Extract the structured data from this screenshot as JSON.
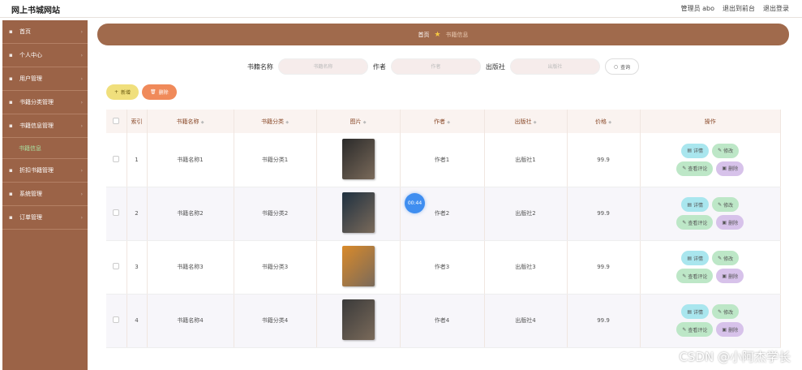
{
  "header": {
    "logo": "网上书城网站",
    "links": [
      "管理员 abo",
      "退出到前台",
      "退出登录"
    ]
  },
  "sidebar": {
    "items": [
      {
        "label": "首页",
        "icon": "home-icon"
      },
      {
        "label": "个人中心",
        "icon": "user-icon"
      },
      {
        "label": "用户管理",
        "icon": "users-icon"
      },
      {
        "label": "书籍分类管理",
        "icon": "list-icon"
      },
      {
        "label": "书籍信息管理",
        "icon": "book-icon"
      },
      {
        "label": "书籍信息",
        "sub": true
      },
      {
        "label": "折扣书籍管理",
        "icon": "user-icon"
      },
      {
        "label": "系统管理",
        "icon": "settings-icon"
      },
      {
        "label": "订单管理",
        "icon": "grid-icon"
      }
    ]
  },
  "breadcrumb": {
    "home": "首页",
    "current": "书籍信息"
  },
  "search": {
    "fields": [
      {
        "label": "书籍名称",
        "placeholder": "书籍名称"
      },
      {
        "label": "作者",
        "placeholder": "作者"
      },
      {
        "label": "出版社",
        "placeholder": "出版社"
      }
    ],
    "button": "查询"
  },
  "toolbar": {
    "add": "新增",
    "delete": "删除"
  },
  "table": {
    "headers": [
      "索引",
      "书籍名称",
      "书籍分类",
      "图片",
      "作者",
      "出版社",
      "价格",
      "操作"
    ],
    "rows": [
      {
        "idx": "1",
        "name": "书籍名称1",
        "cat": "书籍分类1",
        "author": "作者1",
        "pub": "出版社1",
        "price": "99.9",
        "cover": "#2a2a2a"
      },
      {
        "idx": "2",
        "name": "书籍名称2",
        "cat": "书籍分类2",
        "author": "作者2",
        "pub": "出版社2",
        "price": "99.9",
        "cover": "#1f3040"
      },
      {
        "idx": "3",
        "name": "书籍名称3",
        "cat": "书籍分类3",
        "author": "作者3",
        "pub": "出版社3",
        "price": "99.9",
        "cover": "#d98a2a"
      },
      {
        "idx": "4",
        "name": "书籍名称4",
        "cat": "书籍分类4",
        "author": "作者4",
        "pub": "出版社4",
        "price": "99.9",
        "cover": "#3a3a3a"
      }
    ],
    "ops": {
      "detail": "详情",
      "edit": "修改",
      "review": "查看评论",
      "remove": "删除"
    }
  },
  "timer": "00:44",
  "watermark": "CSDN @小阿杰学长"
}
